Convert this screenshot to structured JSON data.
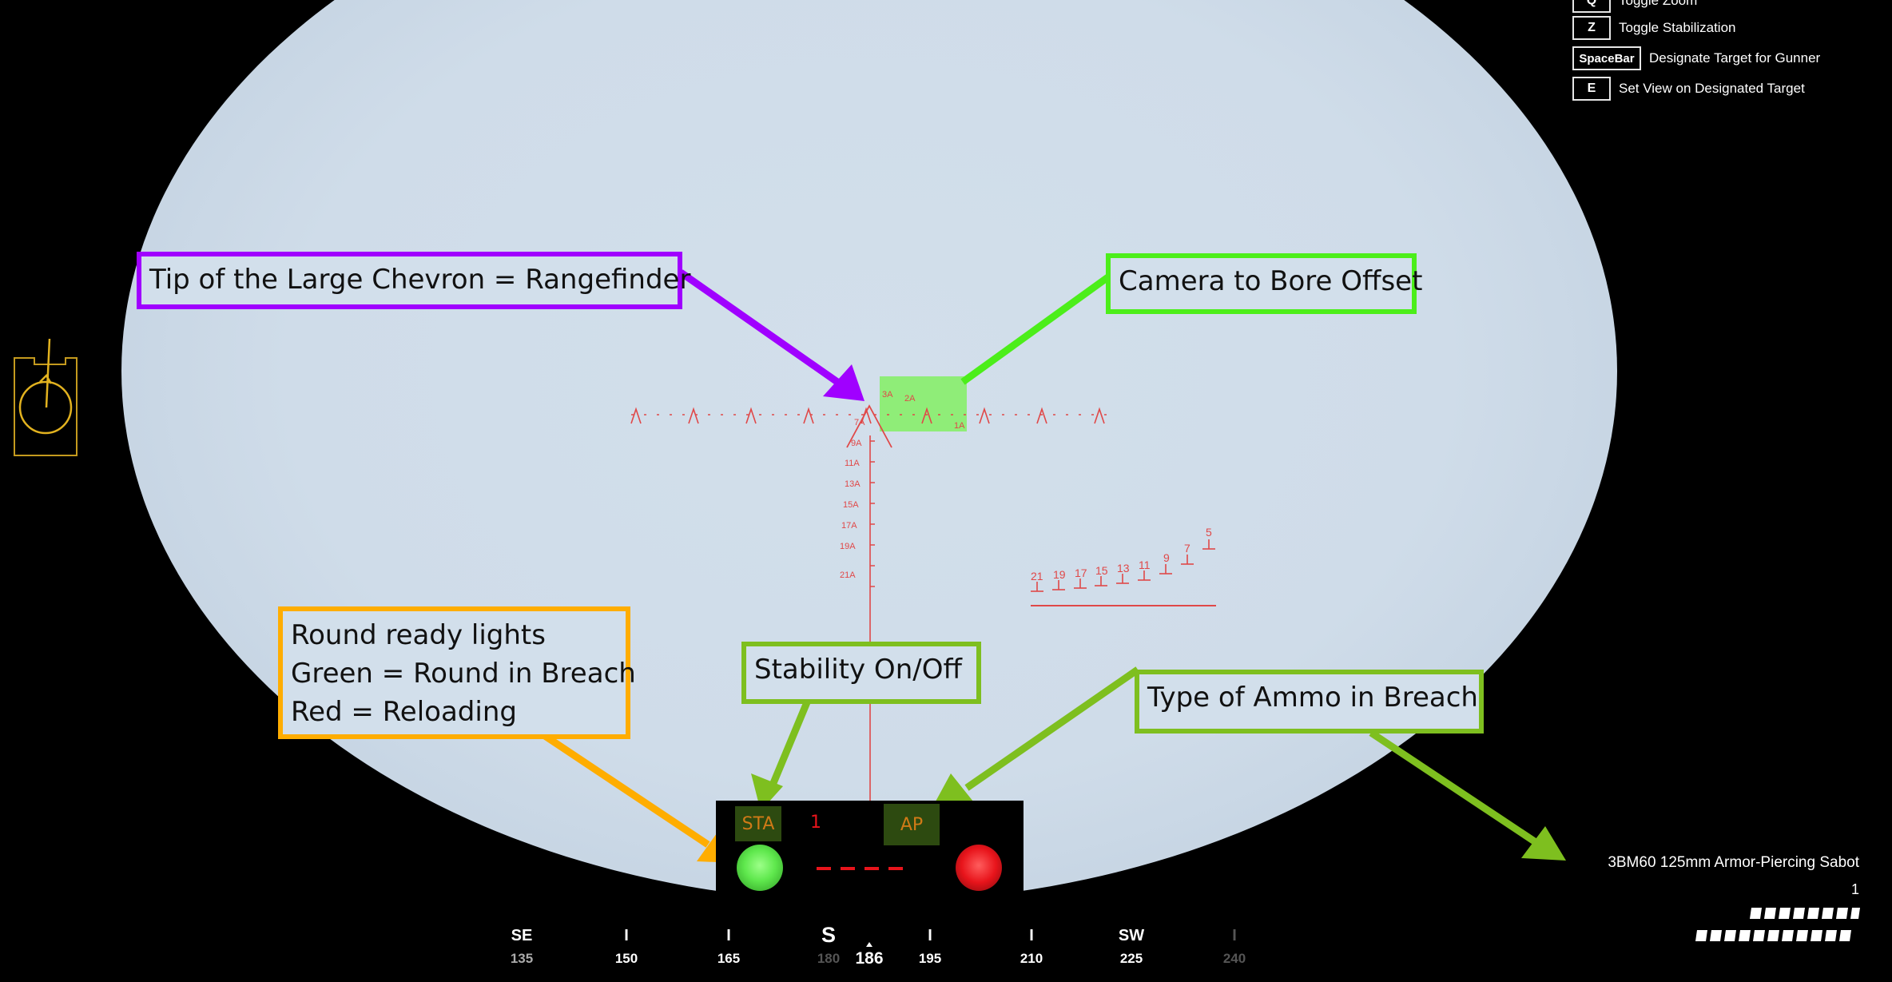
{
  "keybinds": [
    {
      "key": "Q",
      "label": "Toggle Zoom"
    },
    {
      "key": "Z",
      "label": "Toggle Stabilization"
    },
    {
      "key": "SpaceBar",
      "label": "Designate Target for Gunner"
    },
    {
      "key": "E",
      "label": "Set View on Designated Target"
    }
  ],
  "callouts": {
    "rangefinder": "Tip of the Large Chevron = Rangefinder",
    "bore_offset": "Camera to Bore Offset",
    "round_ready_line1": "Round ready lights",
    "round_ready_line2": "Green = Round in Breach",
    "round_ready_line3": "Red = Reloading",
    "stability": "Stability On/Off",
    "ammo_type": "Type of Ammo in Breach"
  },
  "panel": {
    "sta_label": "STA",
    "round_count": "1",
    "ammo_badge": "AP"
  },
  "reticle": {
    "offset_labels": [
      "3A",
      "2A",
      "1A"
    ],
    "range_labels": [
      "7A",
      "9A",
      "11A",
      "13A",
      "15A",
      "17A",
      "19A",
      "21A"
    ],
    "lead_labels": [
      "21",
      "19",
      "17",
      "15",
      "13",
      "11",
      "9",
      "7",
      "5"
    ]
  },
  "compass": {
    "ticks": [
      {
        "label": "SE",
        "num": "135",
        "dim": false
      },
      {
        "label": "I",
        "num": "150",
        "dim": false
      },
      {
        "label": "I",
        "num": "165",
        "dim": false
      },
      {
        "label": "S",
        "num": "180",
        "dim": true
      },
      {
        "label": "I",
        "num": "195",
        "dim": false
      },
      {
        "label": "I",
        "num": "210",
        "dim": false
      },
      {
        "label": "SW",
        "num": "225",
        "dim": false
      },
      {
        "label": "I",
        "num": "240",
        "dim": true
      }
    ],
    "heading": "186"
  },
  "ammo": {
    "name": "3BM60 125mm Armor-Piercing Sabot",
    "count": "1"
  },
  "colors": {
    "callout_purple": "#a000ff",
    "callout_green": "#4cee1a",
    "callout_orange": "#ffad00",
    "callout_olive": "#7ebf1f",
    "reticle_red": "#e04848",
    "lamp_green": "#5fe84d",
    "lamp_red": "#e8141b"
  }
}
